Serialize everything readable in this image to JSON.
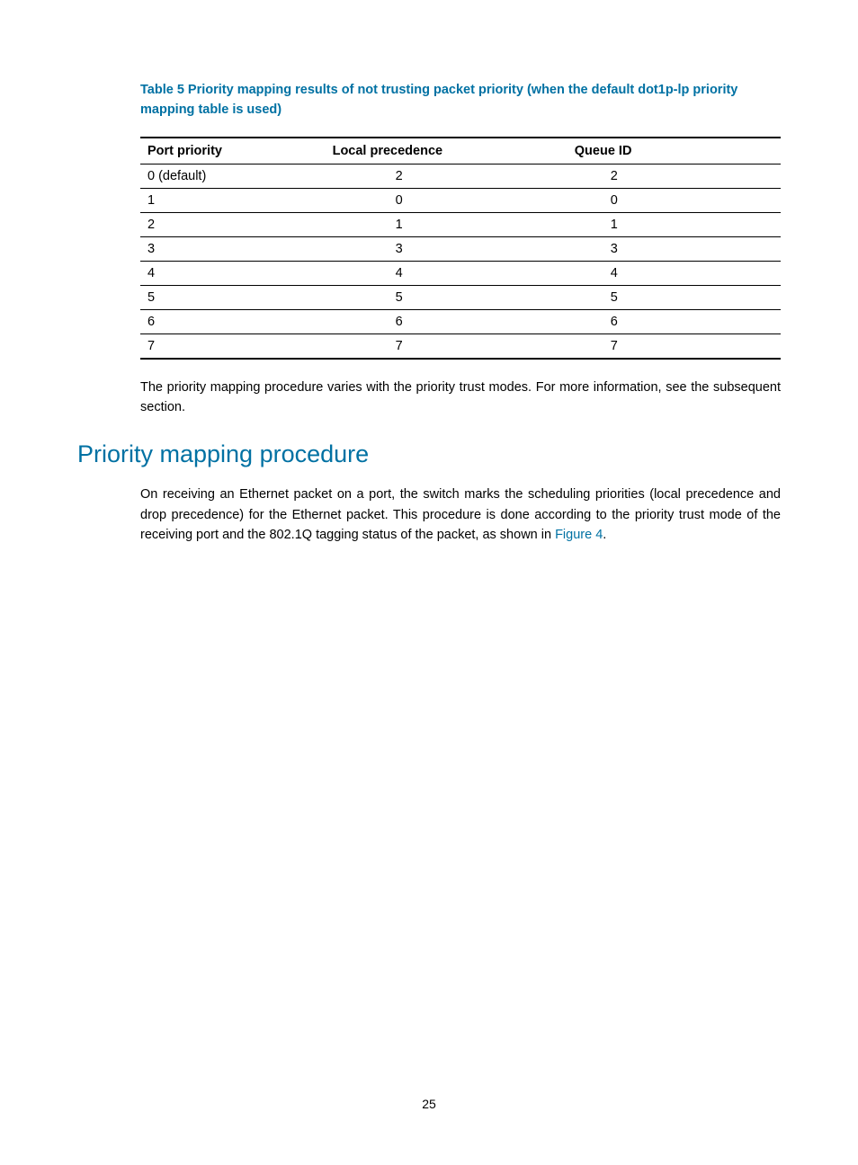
{
  "table": {
    "caption": "Table 5 Priority mapping results of not trusting packet priority (when the default dot1p-lp priority mapping table is used)",
    "headers": [
      "Port priority",
      "Local precedence",
      "Queue ID"
    ],
    "rows": [
      [
        "0 (default)",
        "2",
        "2"
      ],
      [
        "1",
        "0",
        "0"
      ],
      [
        "2",
        "1",
        "1"
      ],
      [
        "3",
        "3",
        "3"
      ],
      [
        "4",
        "4",
        "4"
      ],
      [
        "5",
        "5",
        "5"
      ],
      [
        "6",
        "6",
        "6"
      ],
      [
        "7",
        "7",
        "7"
      ]
    ]
  },
  "paragraph_after_table": "The priority mapping procedure varies with the priority trust modes. For more information, see the subsequent section.",
  "heading": "Priority mapping procedure",
  "paragraph_body_part1": "On receiving an Ethernet packet on a port, the switch marks the scheduling priorities (local precedence and drop precedence) for the Ethernet packet. This procedure is done according to the priority trust mode of the receiving port and the 802.1Q tagging status of the packet, as shown in ",
  "paragraph_body_link": "Figure 4",
  "paragraph_body_part2": ".",
  "page_number": "25"
}
